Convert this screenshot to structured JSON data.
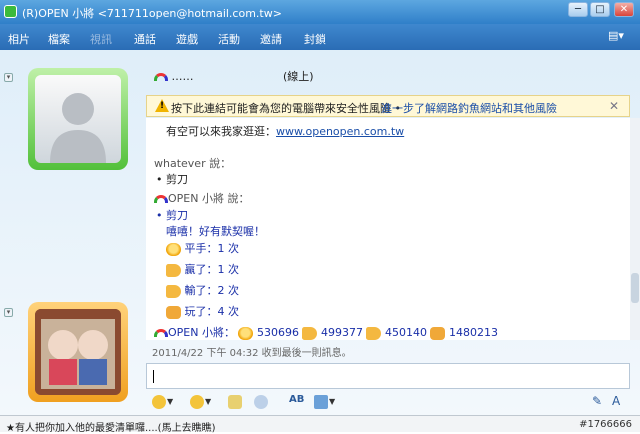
{
  "window": {
    "title": "(R)OPEN 小將 <711711open@hotmail.com.tw>",
    "min_label": "─",
    "max_label": "□",
    "close_label": "✕"
  },
  "menu": {
    "items": [
      "相片",
      "檔案",
      "視訊",
      "通話",
      "遊戲",
      "活動",
      "邀請",
      "封鎖"
    ],
    "dim_index": 2
  },
  "contact": {
    "name": "……",
    "status": "(線上)"
  },
  "warning": {
    "text": "按下此連結可能會為您的電腦帶來安全性風險 •",
    "link": "進一步了解網路釣魚網站和其他風險",
    "close": "✕"
  },
  "messages": {
    "invite_text": "有空可以來我家逛逛：",
    "invite_url": "www.openopen.com.tw",
    "whatever_says": "whatever 說：",
    "whatever_msg": "剪刀",
    "open_says": "OPEN 小將 說：",
    "open_msg1": "剪刀",
    "open_msg2": "嘻嘻！好有默契喔！",
    "tie": "平手：1 次",
    "win": "贏了：1 次",
    "lose": "輸了：2 次",
    "play": "玩了：4 次",
    "stats_prefix": "OPEN 小將：",
    "stat1": "530696",
    "stat2": "499377",
    "stat3": "450140",
    "stat4": "1480213"
  },
  "timestamp": "2011/4/22 下午 04:32 收到最後一則訊息。",
  "statusbar": {
    "message": "★有人把你加入他的最愛清單囉....(馬上去瞧瞧)",
    "tag": "#1766666"
  },
  "colors": {
    "title_bg": "#2f7fc9",
    "frame_green": "#52c03a",
    "frame_orange": "#f0a020",
    "link": "#1a4ea8"
  }
}
